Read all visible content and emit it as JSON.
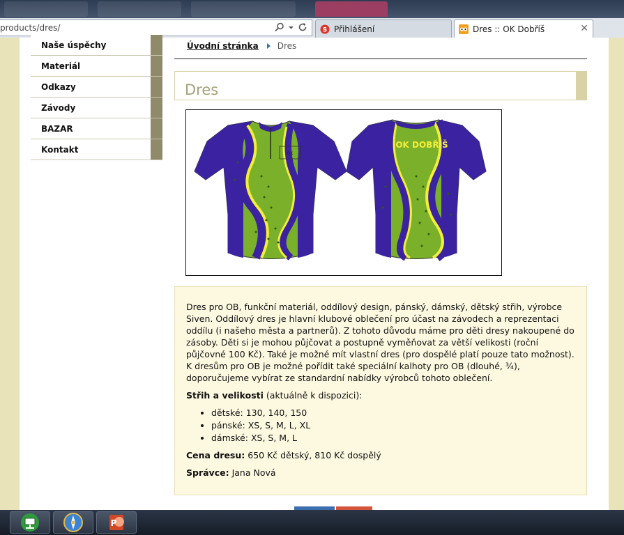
{
  "browser": {
    "address": "products/dres/",
    "tabs": [
      {
        "label": "Přihlášení"
      },
      {
        "label": "Dres :: OK Dobříš"
      }
    ],
    "close_glyph": "✕"
  },
  "sidebar": {
    "items": [
      {
        "label": "Naše úspěchy"
      },
      {
        "label": "Materiál"
      },
      {
        "label": "Odkazy"
      },
      {
        "label": "Závody"
      },
      {
        "label": "BAZAR"
      },
      {
        "label": "Kontakt"
      }
    ]
  },
  "breadcrumb": {
    "home": "Úvodní stránka",
    "current": "Dres"
  },
  "page": {
    "title": "Dres",
    "jersey_text": "OK DOBŘÍŠ",
    "description": "Dres pro OB, funkční materiál, oddílový design, pánský, dámský, dětský střih, výrobce Siven. Oddílový dres je hlavní klubové oblečení pro účast na závodech a reprezentaci oddílu (i našeho města a partnerů). Z tohoto důvodu máme pro děti dresy nakoupené do zásoby. Děti si je mohou půjčovat a postupně vyměňovat za větší velikosti (roční půjčovné 100 Kč). Také je možné mít vlastní dres (pro dospělé platí pouze tato možnost). K dresům pro OB je možné pořídit také speciální kalhoty pro OB (dlouhé, ¾), doporučujeme vybírat ze standardní nabídky výrobců tohoto oblečení.",
    "sizes_label": "Střih a velikosti",
    "sizes_note": " (aktuálně k dispozici):",
    "sizes": [
      "dětské: 130, 140, 150",
      "pánské: XS, S, M, L, XL",
      "dámské: XS, S, M, L"
    ],
    "price_label": "Cena dresu:",
    "price_value": " 650 Kč dětský, 810 Kč dospělý",
    "admin_label": "Správce:",
    "admin_value": " Jana Nová"
  },
  "colors": {
    "accent_olive": "#8f8a69",
    "page_bg": "#e9e3b9",
    "info_bg": "#fdf9e1",
    "jersey_green": "#7ab02a",
    "jersey_purple": "#3b22a0",
    "jersey_yellow": "#f3ee3a"
  },
  "taskbar": {
    "apps": [
      {
        "icon": "network-icon"
      },
      {
        "icon": "browser-icon"
      },
      {
        "icon": "powerpoint-icon"
      }
    ]
  }
}
